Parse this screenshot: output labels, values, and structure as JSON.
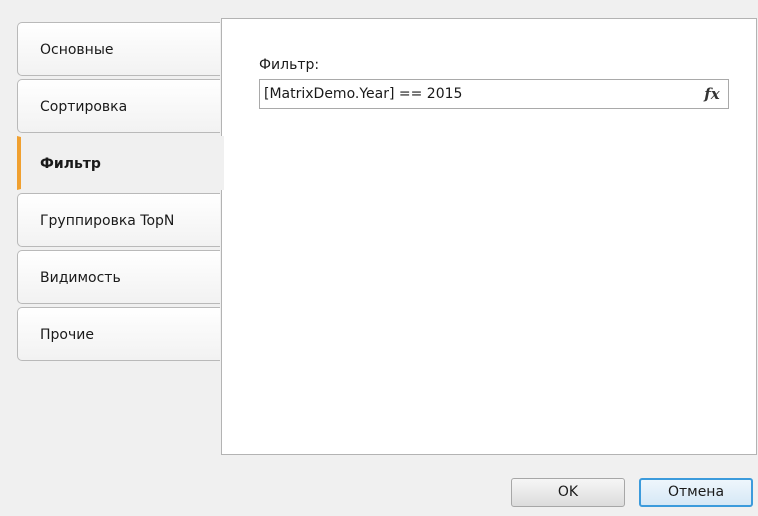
{
  "tabs": [
    {
      "label": "Основные"
    },
    {
      "label": "Сортировка"
    },
    {
      "label": "Фильтр"
    },
    {
      "label": "Группировка TopN"
    },
    {
      "label": "Видимость"
    },
    {
      "label": "Прочие"
    }
  ],
  "active_tab_index": 2,
  "filter": {
    "label": "Фильтр:",
    "value": "[MatrixDemo.Year] == 2015",
    "fx_label": "fx"
  },
  "buttons": {
    "ok": "OK",
    "cancel": "Отмена"
  },
  "colors": {
    "active_tab_accent": "#f0a030",
    "cancel_focus_border": "#3c9bdc"
  }
}
